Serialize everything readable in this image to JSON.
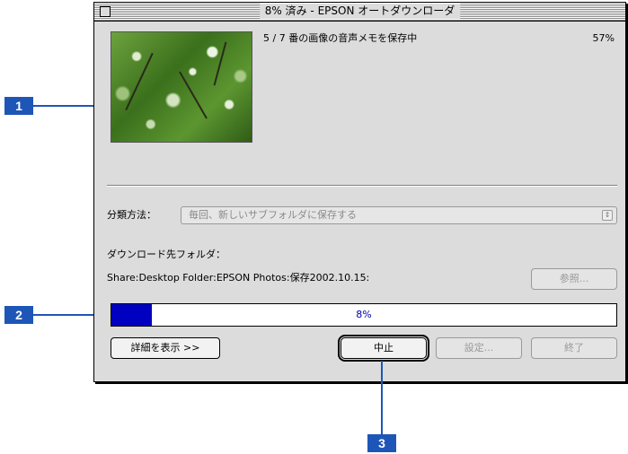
{
  "window": {
    "title": "8% 済み - EPSON オートダウンローダ"
  },
  "progress_info": {
    "status": "5 / 7 番の画像の音声メモを保存中",
    "item_percent": "57%",
    "overall_percent_text": "8%",
    "overall_fraction": 0.08
  },
  "classification": {
    "label": "分類方法：",
    "selected": "毎回、新しいサブフォルダに保存する"
  },
  "download_folder": {
    "label": "ダウンロード先フォルダ：",
    "path": "Share:Desktop Folder:EPSON Photos:保存2002.10.15:",
    "browse_label": "参照..."
  },
  "buttons": {
    "details": "詳細を表示 >>",
    "stop": "中止",
    "settings": "設定...",
    "quit": "終了"
  },
  "callouts": [
    "1",
    "2",
    "3"
  ],
  "colors": {
    "callout": "#1e56b8",
    "progress_fill": "#0000c0"
  }
}
